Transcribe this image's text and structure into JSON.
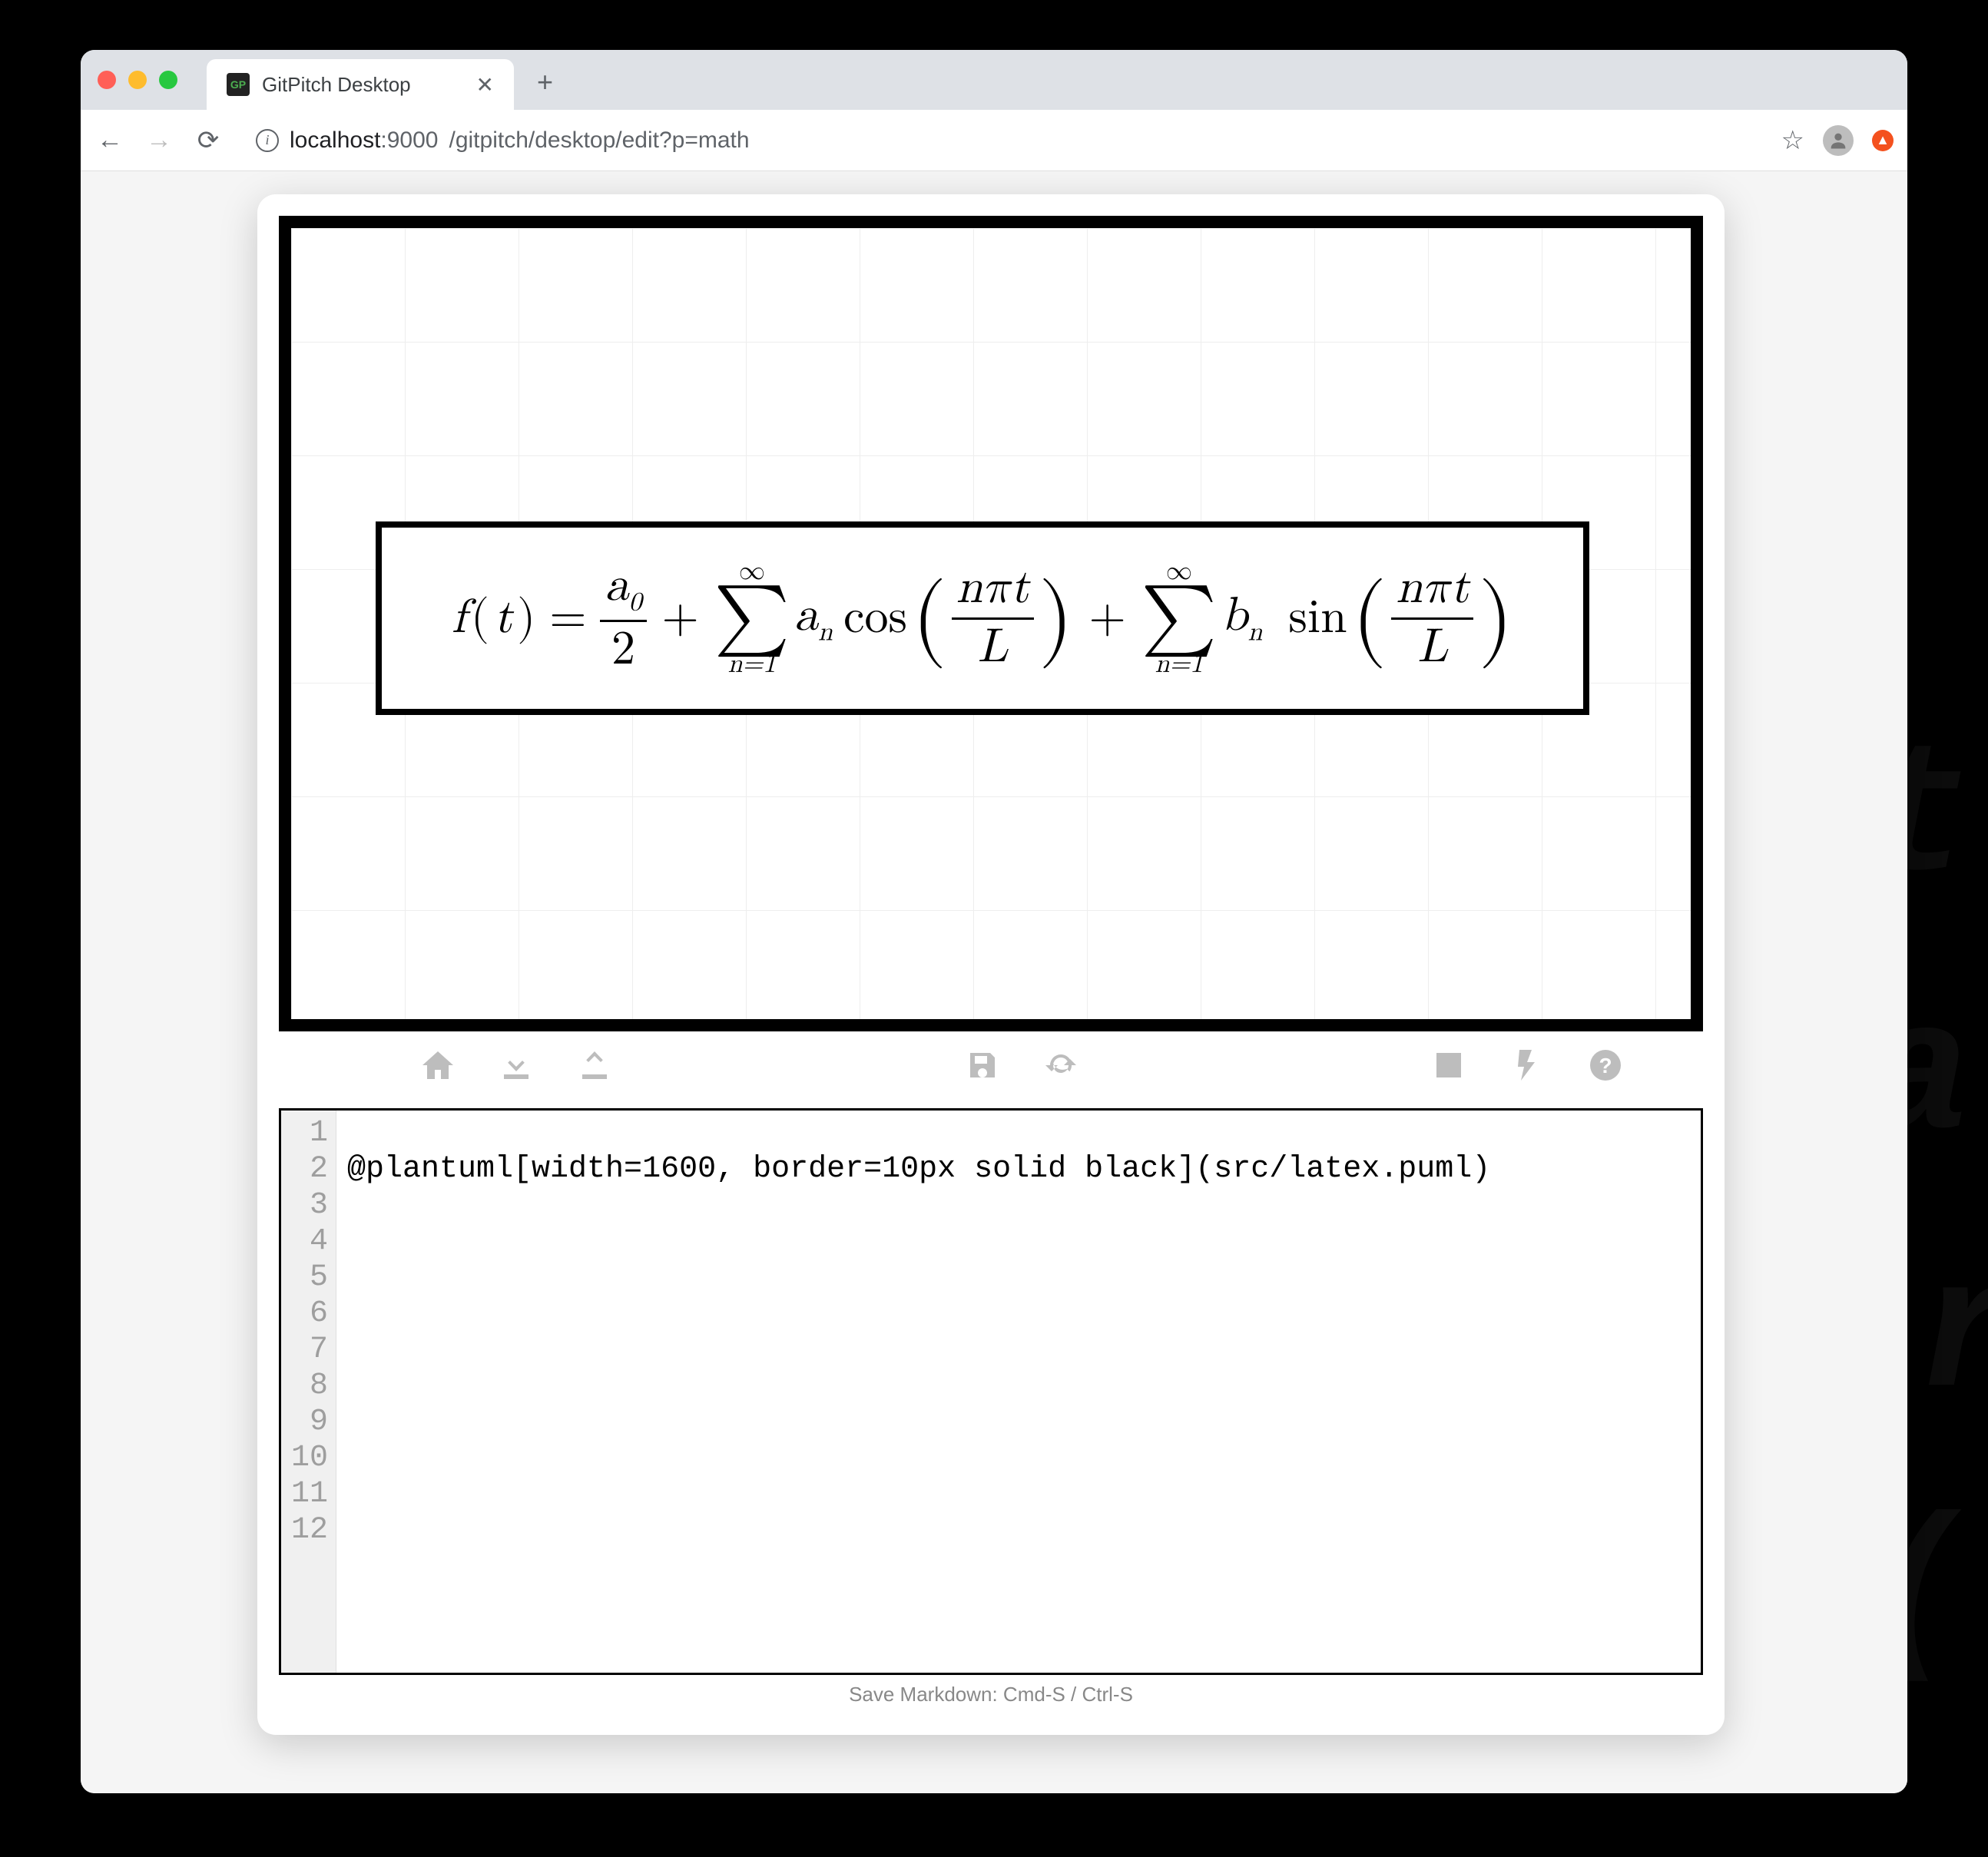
{
  "browser": {
    "tab_title": "GitPitch Desktop",
    "favicon_text": "GP",
    "url_host": "localhost",
    "url_port": ":9000",
    "url_path": "/gitpitch/desktop/edit?p=math"
  },
  "slide": {
    "formula_label": "Fourier series: f(t) = a0/2 + Σ an cos(nπt/L) + Σ bn sin(nπt/L)"
  },
  "toolbar": {
    "home": "home-icon",
    "download": "download-icon",
    "upload": "upload-icon",
    "save": "save-icon",
    "refresh": "refresh-icon",
    "image": "image-icon",
    "flash": "flash-icon",
    "help": "help-icon"
  },
  "editor": {
    "line_count": 12,
    "lines": [
      "",
      "@plantuml[width=1600, border=10px solid black](src/latex.puml)",
      "",
      "",
      "",
      "",
      "",
      "",
      "",
      "",
      "",
      ""
    ]
  },
  "statusbar": {
    "hint": "Save Markdown: Cmd-S / Ctrl-S"
  },
  "watermark": {
    "l1": "et",
    "l2": "pa",
    "l3": "ar",
    "l4": "d("
  }
}
